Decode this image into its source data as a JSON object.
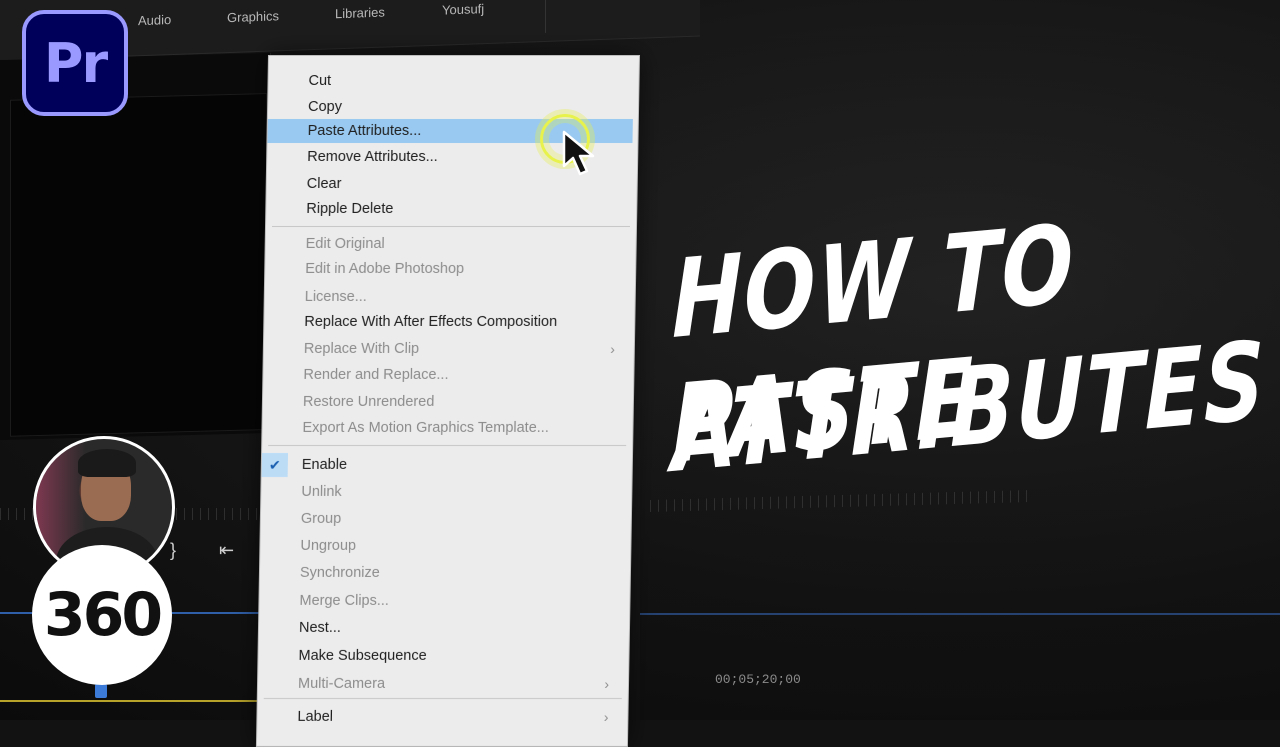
{
  "top_tabs": [
    "Audio",
    "Graphics",
    "Libraries",
    "Yousufj"
  ],
  "top_tabs_more": "»",
  "logo_text": "Pr",
  "badge_text": "360",
  "timecode": "00;05;20;00",
  "title_line1": "HOW TO PASTE",
  "title_line2": "ATTRIBUTES",
  "menu": {
    "group1": [
      {
        "label": "Cut",
        "disabled": false
      },
      {
        "label": "Copy",
        "disabled": false
      },
      {
        "label": "Paste Attributes...",
        "disabled": false,
        "highlighted": true
      },
      {
        "label": "Remove Attributes...",
        "disabled": false
      },
      {
        "label": "Clear",
        "disabled": false
      },
      {
        "label": "Ripple Delete",
        "disabled": false
      }
    ],
    "group2": [
      {
        "label": "Edit Original",
        "disabled": true
      },
      {
        "label": "Edit in Adobe Photoshop",
        "disabled": true
      },
      {
        "label": "License...",
        "disabled": true
      },
      {
        "label": "Replace With After Effects Composition",
        "disabled": false
      },
      {
        "label": "Replace With Clip",
        "disabled": true,
        "submenu": true
      },
      {
        "label": "Render and Replace...",
        "disabled": true
      },
      {
        "label": "Restore Unrendered",
        "disabled": true
      },
      {
        "label": "Export As Motion Graphics Template...",
        "disabled": true
      }
    ],
    "group3": [
      {
        "label": "Enable",
        "disabled": false,
        "checked": true
      },
      {
        "label": "Unlink",
        "disabled": true
      },
      {
        "label": "Group",
        "disabled": true
      },
      {
        "label": "Ungroup",
        "disabled": true
      },
      {
        "label": "Synchronize",
        "disabled": true
      },
      {
        "label": "Merge Clips...",
        "disabled": true
      },
      {
        "label": "Nest...",
        "disabled": false
      },
      {
        "label": "Make Subsequence",
        "disabled": false
      },
      {
        "label": "Multi-Camera",
        "disabled": true,
        "submenu": true
      }
    ],
    "group4": [
      {
        "label": "Label",
        "disabled": false,
        "submenu": true
      }
    ],
    "submenu_glyph": "›",
    "check_glyph": "✔"
  },
  "colors": {
    "menu_bg": "#ececec",
    "highlight": "#99c9f0",
    "pr_dark": "#00005b",
    "pr_light": "#9999ff",
    "cursor_ring": "#e8f24c"
  }
}
